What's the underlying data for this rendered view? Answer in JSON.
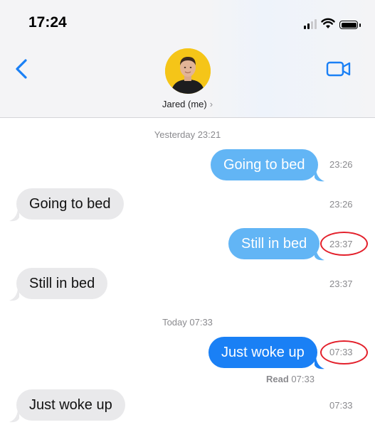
{
  "status_bar": {
    "time": "17:24"
  },
  "header": {
    "contact_name": "Jared (me)",
    "contact_chevron": "›",
    "back_icon": "chevron-left-icon",
    "video_icon": "video-camera-icon"
  },
  "colors": {
    "sent_bubble": "#62b5f5",
    "sent_bubble_latest": "#1a80f5",
    "received_bubble": "#e9e9eb",
    "highlight_circle": "#e3202b",
    "accent": "#1a80f5"
  },
  "timestamps": {
    "yesterday": "Yesterday 23:21",
    "today": "Today 07:33"
  },
  "messages": [
    {
      "direction": "sent",
      "text": "Going to bed",
      "time": "23:26"
    },
    {
      "direction": "received",
      "text": "Going to bed",
      "time": "23:26"
    },
    {
      "direction": "sent",
      "text": "Still in bed",
      "time": "23:37",
      "highlighted": true
    },
    {
      "direction": "received",
      "text": "Still in bed",
      "time": "23:37"
    },
    {
      "direction": "sent",
      "text": "Just woke up",
      "time": "07:33",
      "highlighted": true
    },
    {
      "direction": "received",
      "text": "Just woke up",
      "time": "07:33"
    }
  ],
  "read_receipt": {
    "label": "Read",
    "time": "07:33"
  }
}
